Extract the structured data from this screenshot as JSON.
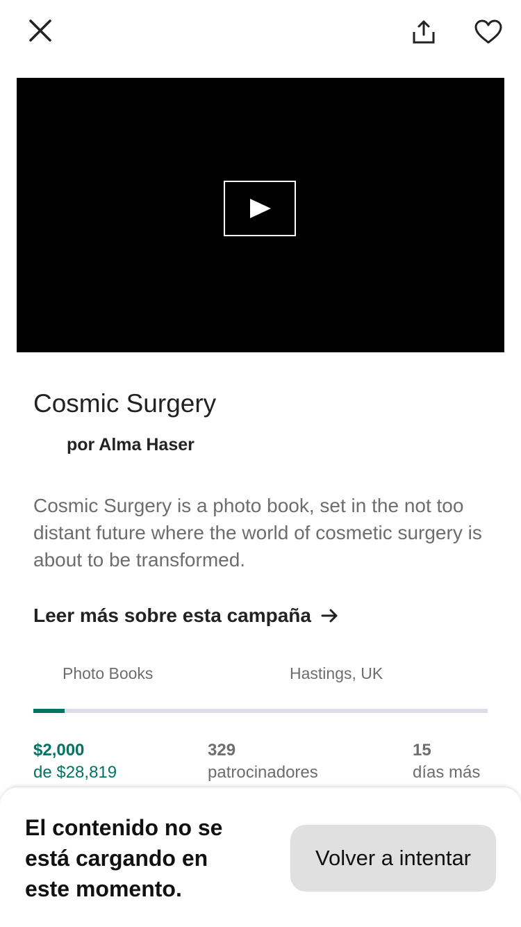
{
  "header": {
    "close_icon": "close-icon",
    "share_icon": "share-icon",
    "favorite_icon": "heart-icon"
  },
  "video": {
    "play_icon": "play-icon"
  },
  "project": {
    "title": "Cosmic Surgery",
    "creator": "por Alma Haser",
    "blurb": "Cosmic Surgery is a photo book, set in the not too distant future where the world of cosmetic surgery is about to be transformed.",
    "read_more": "Leer más sobre esta campaña",
    "category": "Photo Books",
    "location": "Hastings, UK",
    "progress_fraction": 0.069
  },
  "stats": {
    "pledged": "$2,000",
    "goal": "de $28,819",
    "backers_count": "329",
    "backers_label": "patrocinadores",
    "days_count": "15",
    "days_label": "días más"
  },
  "error": {
    "message": "El contenido no se está cargando en este momento.",
    "retry_label": "Volver a intentar"
  },
  "colors": {
    "accent": "#037362",
    "track": "#dcdde5",
    "retry_bg": "#dfe0df"
  }
}
